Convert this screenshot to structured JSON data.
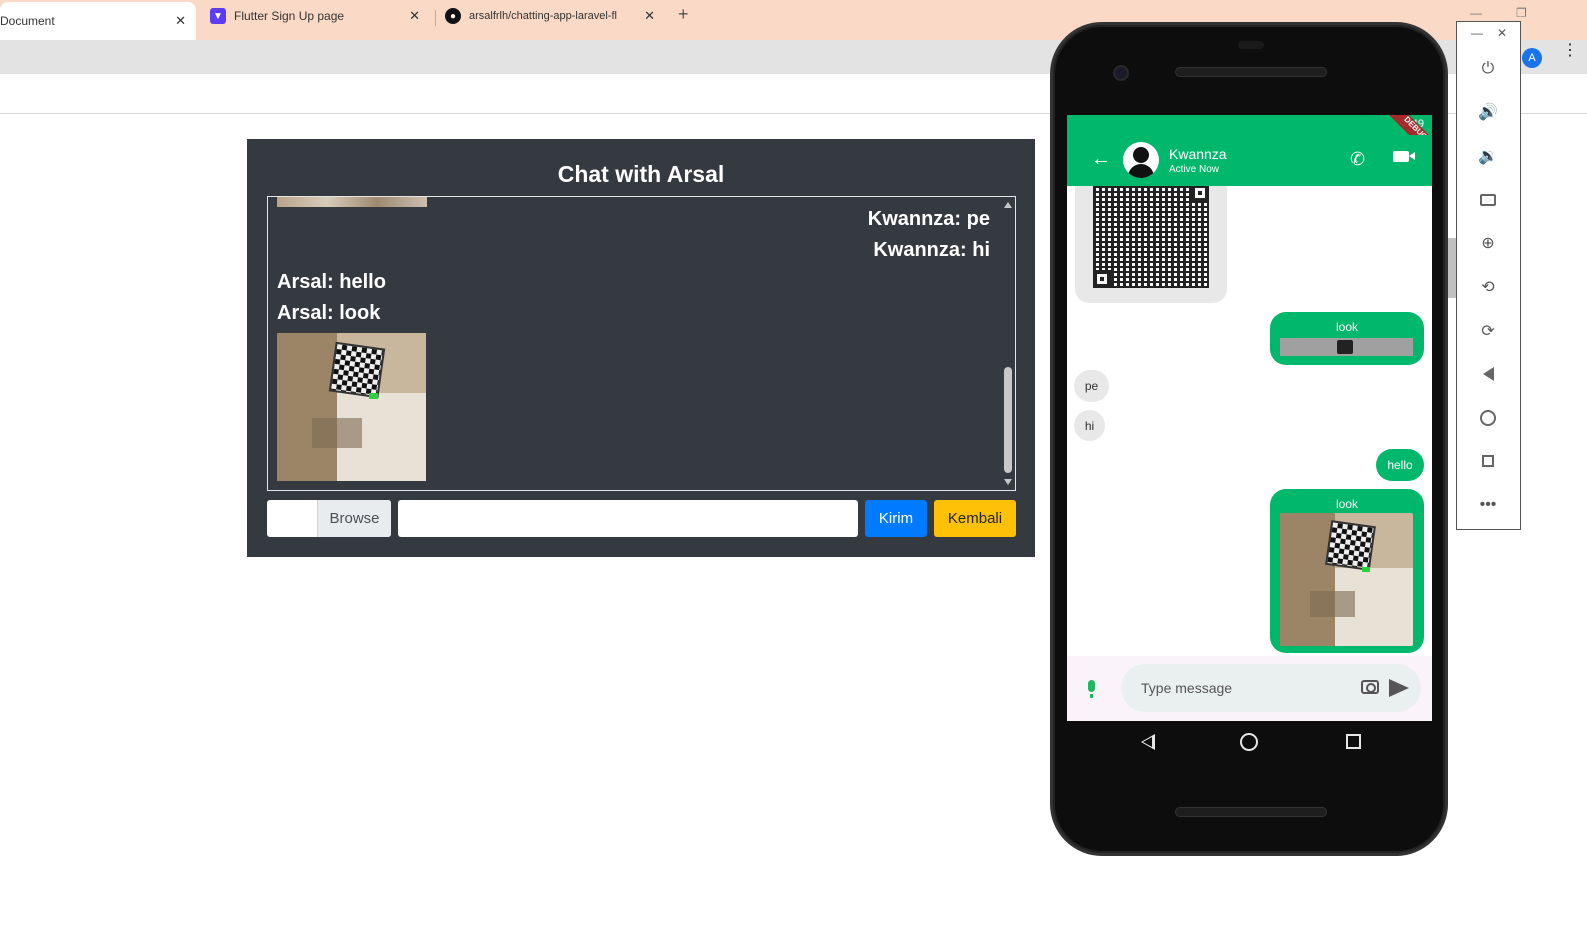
{
  "browser": {
    "tabs": [
      {
        "label": "Document",
        "active": true,
        "close": "✕"
      },
      {
        "label": "Flutter Sign Up page",
        "active": false,
        "close": "✕"
      },
      {
        "label": "arsalfrlh/chatting-app-laravel-fl",
        "active": false,
        "close": "✕"
      }
    ],
    "new_tab": "+",
    "profile_initial": "A"
  },
  "chat": {
    "title": "Chat with Arsal",
    "messages": [
      {
        "text": "Kwannza: pe",
        "side": "right"
      },
      {
        "text": "Kwannza: hi",
        "side": "right"
      },
      {
        "text": "Arsal: hello",
        "side": "left"
      },
      {
        "text": "Arsal: look",
        "side": "left"
      }
    ],
    "browse_label": "Browse",
    "message_value": "",
    "send_label": "Kirim",
    "back_label": "Kembali"
  },
  "phone": {
    "status_time": "49",
    "debug_label": "DEBUG",
    "contact_name": "Kwannza",
    "contact_status": "Active Now",
    "messages": [
      {
        "type": "image-broken",
        "label": "look",
        "side": "right"
      },
      {
        "type": "text",
        "text": "pe",
        "side": "left"
      },
      {
        "type": "text",
        "text": "hi",
        "side": "left"
      },
      {
        "type": "text",
        "text": "hello",
        "side": "right"
      },
      {
        "type": "image",
        "label": "look",
        "side": "right"
      }
    ],
    "input_placeholder": "Type message"
  },
  "colors": {
    "card_bg": "#343a40",
    "primary": "#007bff",
    "warning": "#ffc107",
    "app_green": "#00b86b"
  }
}
